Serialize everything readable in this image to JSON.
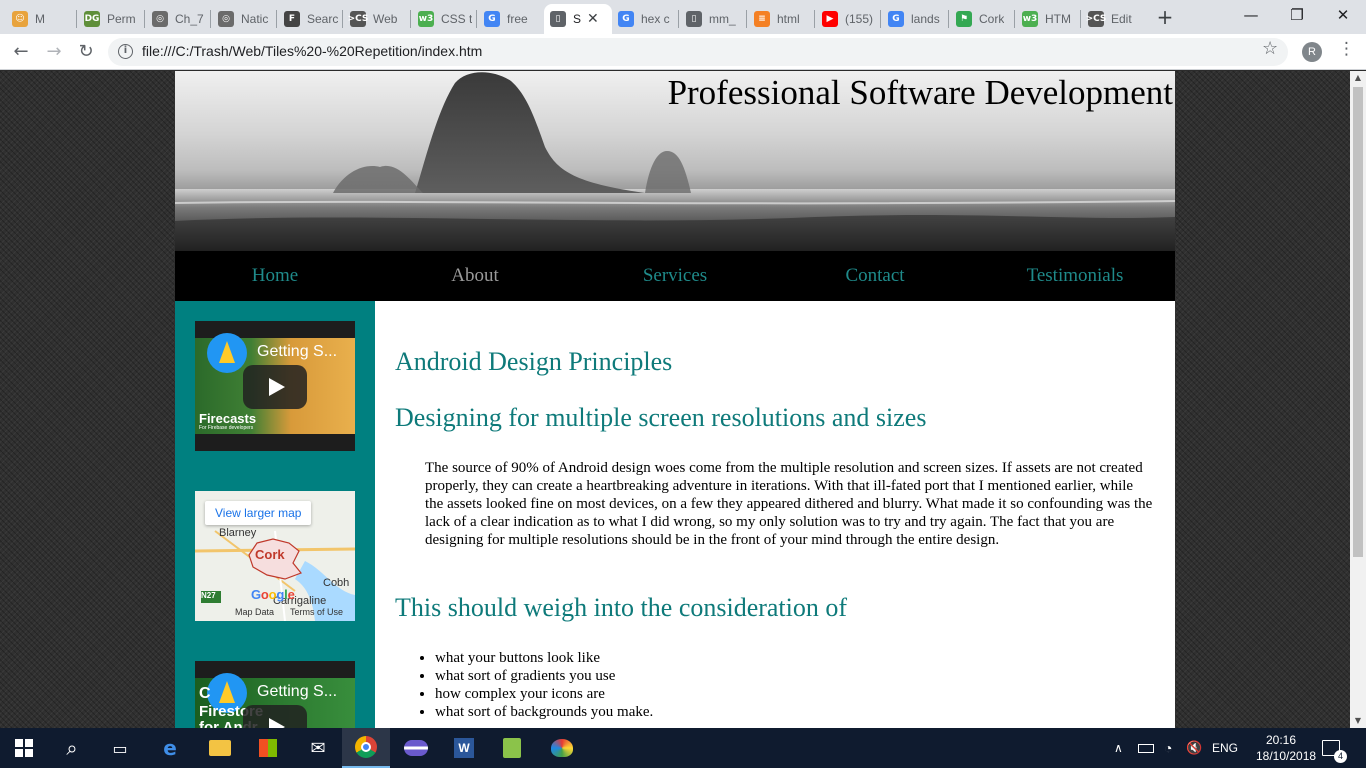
{
  "browser": {
    "tabs": [
      {
        "title": "M",
        "icon": "emoji-icon",
        "color": "#e8a33d",
        "glyph": "☺"
      },
      {
        "title": "Perm",
        "icon": "dg-icon",
        "color": "#5f8f3a",
        "glyph": "DG"
      },
      {
        "title": "Ch_7",
        "icon": "atom-icon",
        "color": "#6b6b6b",
        "glyph": "◎"
      },
      {
        "title": "Natic",
        "icon": "atom-icon",
        "color": "#6b6b6b",
        "glyph": "◎"
      },
      {
        "title": "Searc",
        "icon": "first-icon",
        "color": "#444444",
        "glyph": "F"
      },
      {
        "title": "Web",
        "icon": "cs-icon",
        "color": "#555555",
        "glyph": ">CS"
      },
      {
        "title": "CSS t",
        "icon": "w3-icon",
        "color": "#4caf50",
        "glyph": "w3"
      },
      {
        "title": "free",
        "icon": "google-icon",
        "color": "#4285f4",
        "glyph": "G"
      },
      {
        "title": "S",
        "icon": "document-icon",
        "color": "#5f6368",
        "glyph": "▯",
        "active": true
      },
      {
        "title": "hex c",
        "icon": "google-icon",
        "color": "#4285f4",
        "glyph": "G"
      },
      {
        "title": "mm_",
        "icon": "document-icon",
        "color": "#5f6368",
        "glyph": "▯"
      },
      {
        "title": "html",
        "icon": "stackoverflow-icon",
        "color": "#f48024",
        "glyph": "≡"
      },
      {
        "title": "(155)",
        "icon": "youtube-icon",
        "color": "#ff0000",
        "glyph": "▶"
      },
      {
        "title": "lands",
        "icon": "google-icon",
        "color": "#4285f4",
        "glyph": "G"
      },
      {
        "title": "Cork",
        "icon": "maps-icon",
        "color": "#34a853",
        "glyph": "⚑"
      },
      {
        "title": "HTM",
        "icon": "w3-icon",
        "color": "#4caf50",
        "glyph": "w3"
      },
      {
        "title": "Edit",
        "icon": "cs-icon",
        "color": "#555555",
        "glyph": ">CS"
      }
    ],
    "new_tab": "+",
    "window_controls": {
      "minimize": "—",
      "restore": "❐",
      "close": "✕"
    },
    "nav": {
      "back": "←",
      "forward": "→",
      "reload": "↻"
    },
    "url": "file:///C:/Trash/Web/Tiles%20-%20Repetition/index.htm",
    "bookmark": "☆",
    "profile_initial": "R",
    "menu": "⋮"
  },
  "site": {
    "title": "Professional Software Development",
    "nav": [
      {
        "label": "Home",
        "current": false
      },
      {
        "label": "About",
        "current": true
      },
      {
        "label": "Services",
        "current": false
      },
      {
        "label": "Contact",
        "current": false
      },
      {
        "label": "Testimonials",
        "current": false
      }
    ],
    "sidebar": {
      "video1": {
        "title": "Getting S...",
        "brand": "Firecasts",
        "brand_sub": "For Firebase developers"
      },
      "map": {
        "view_larger": "View larger map",
        "labels": {
          "blarney": "Blarney",
          "cork": "Cork",
          "cobh": "Cobh",
          "carrigaline": "Carrigaline",
          "n27": "N27"
        },
        "logo": "Google",
        "footer": {
          "data": "Map Data",
          "terms": "Terms of Use"
        }
      },
      "video2": {
        "title": "Getting S...",
        "overlay_c": "C",
        "overlay_firestore": "Firestore",
        "overlay_for": "for Andr"
      }
    },
    "content": {
      "heading1": "Android Design Principles",
      "heading2": "Designing for multiple screen resolutions and sizes",
      "paragraph": "The source of 90% of Android design woes come from the multiple resolution and screen sizes. If assets are not created properly, they can create a heartbreaking adventure in iterations. With that ill-fated port that I mentioned earlier, while the assets looked fine on most devices, on a few they appeared dithered and blurry. What made it so confounding was the lack of a clear indication as to what I did wrong, so my only solution was to try and try again. The fact that you are designing for multiple resolutions should be in the front of your mind through the entire design.",
      "heading3": "This should weigh into the consideration of",
      "list": [
        "what your buttons look like",
        "what sort of gradients you use",
        "how complex your icons are",
        "what sort of backgrounds you make."
      ]
    },
    "colors": {
      "accent": "#0e7a7a",
      "sidebar": "#008080",
      "nav_bg": "#000000"
    }
  },
  "taskbar": {
    "time": "20:16",
    "date": "18/10/2018",
    "language": "ENG",
    "notifications": "4"
  }
}
